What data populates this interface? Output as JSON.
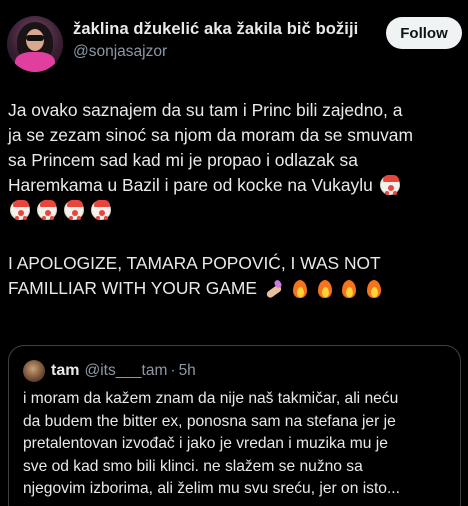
{
  "author": {
    "display_name": "žaklina džukelić aka žakila bič božiji",
    "handle": "@sonjasajzor",
    "avatar": "profile-photo"
  },
  "follow_button": {
    "label": "Follow"
  },
  "tweet": {
    "lines": [
      "Ja ovako saznajem da su tam i Princ bili zajedno, a",
      "ja se zezam sinoć sa njom da moram da se smuvam",
      "sa Princem sad kad mi je propao i odlazak sa",
      "Haremkama u Bazil i pare od kocke na Vukaylu"
    ],
    "line1_emojis": [
      "clown-face-emoji"
    ],
    "emoji_row": [
      "clown-face-emoji",
      "clown-face-emoji",
      "clown-face-emoji",
      "clown-face-emoji"
    ],
    "caps_lines": [
      "I APOLOGIZE, TAMARA POPOVIĆ, I WAS NOT",
      "FAMILLIAR WITH YOUR GAME"
    ],
    "caps_emojis": [
      "nail-polish-emoji",
      "fire-emoji",
      "fire-emoji",
      "fire-emoji",
      "fire-emoji"
    ]
  },
  "quoted_tweet": {
    "name": "tam",
    "handle": "@its___tam",
    "separator": "·",
    "time": "5h",
    "lines": [
      "i moram da kažem znam da nije naš takmičar, ali neću",
      "da budem the bitter ex, ponosna sam na stefana jer je",
      "pretalentovan izvođač i jako je vredan i muzika mu je",
      "sve od kad smo bili klinci. ne slažem se nužno sa",
      "njegovim izborima, ali želim mu svu sreću, jer on isto..."
    ]
  },
  "colors": {
    "background": "#000000",
    "text": "#e7e9ea",
    "secondary_text": "#8b98a5",
    "follow_bg": "#eff3f4",
    "border": "#3e4144"
  }
}
